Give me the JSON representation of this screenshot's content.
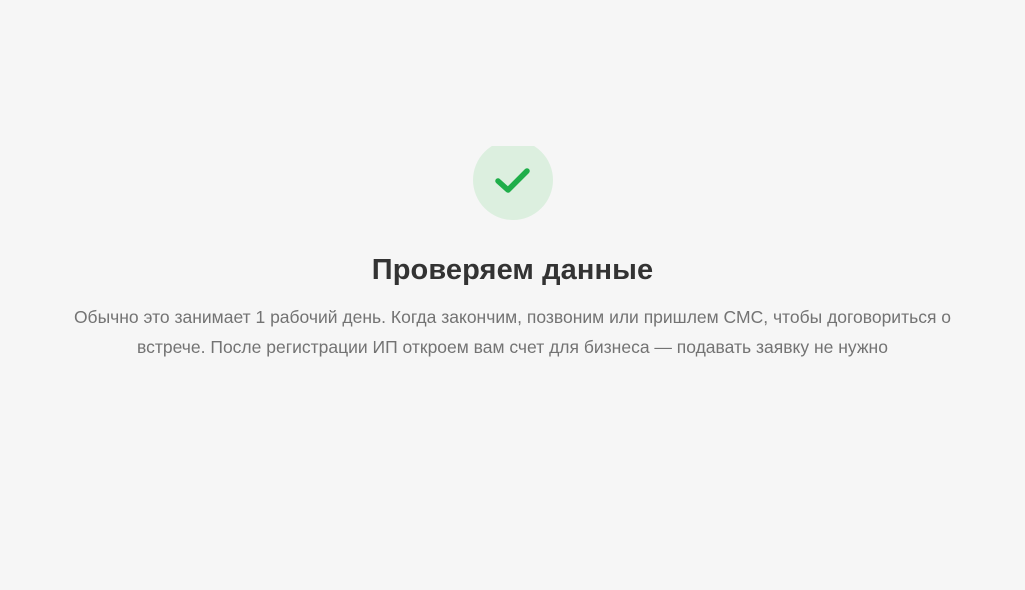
{
  "status": {
    "icon": "check-icon",
    "title": "Проверяем данные",
    "description": "Обычно это занимает 1 рабочий день. Когда закончим, позвоним или пришлем СМС, чтобы договориться о встрече. После регистрации ИП откроем вам счет для бизнеса — подавать заявку не нужно"
  },
  "colors": {
    "background": "#f6f6f6",
    "icon_circle": "#dcefdf",
    "check": "#1fae4a",
    "title": "#333333",
    "description": "#737373"
  }
}
